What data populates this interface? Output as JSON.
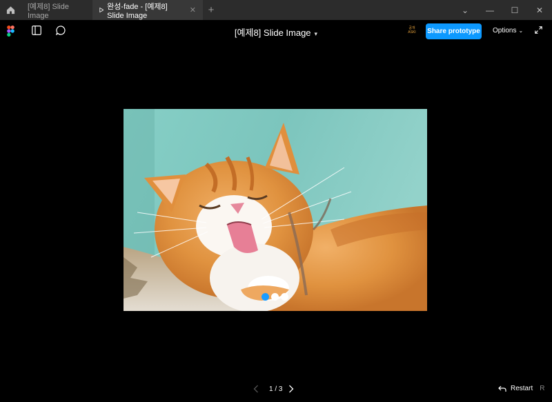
{
  "tabs": [
    {
      "label": "[예제8] Slide Image",
      "active": false
    },
    {
      "label": "완성-fade - [예제8] Slide Image",
      "active": true
    }
  ],
  "toolbar": {
    "file_title": "[예제8] Slide Image",
    "share_label": "Share prototype",
    "options_label": "Options",
    "badge_line1": "공개",
    "badge_line2": "ASKI"
  },
  "slider": {
    "current": 1,
    "total": 3,
    "pager_text": "1 / 3",
    "image_subject": "orange-white-cat-licking-paw"
  },
  "footer": {
    "restart_label": "Restart",
    "restart_key": "R"
  },
  "colors": {
    "accent": "#0d99ff",
    "dot_active": "#1a9cff",
    "tabbar": "#2c2c2c",
    "background": "#000000"
  }
}
